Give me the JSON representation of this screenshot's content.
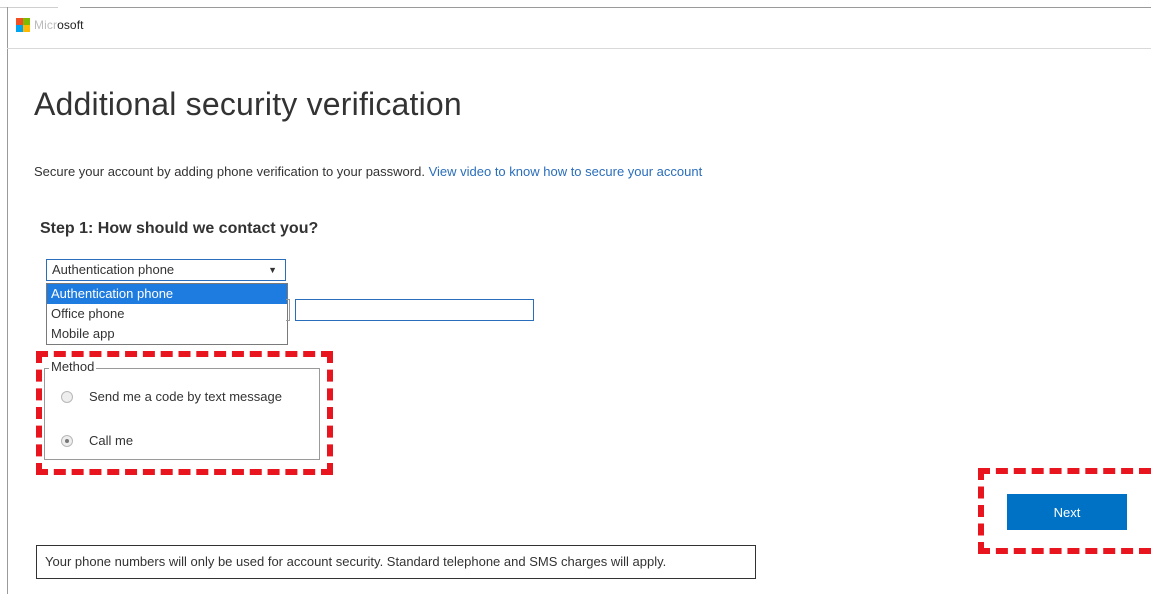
{
  "header": {
    "logo_text_visible": "osoft",
    "logo_text_obscured": "Micr",
    "logo_colors": [
      "#f25022",
      "#7fba00",
      "#00a4ef",
      "#ffb900"
    ]
  },
  "main": {
    "title": "Additional security verification",
    "intro_text": "Secure your account by adding phone verification to your password.",
    "intro_link": "View video to know how to secure your account",
    "step_title": "Step 1: How should we contact you?",
    "contact_select": {
      "selected": "Authentication phone",
      "options": [
        "Authentication phone",
        "Office phone",
        "Mobile app"
      ],
      "highlighted_index": 0
    },
    "phone_number_value": "",
    "method": {
      "legend": "Method",
      "options": [
        {
          "label": "Send me a code by text message",
          "checked": false
        },
        {
          "label": "Call me",
          "checked": true
        }
      ]
    },
    "next_label": "Next",
    "notice": "Your phone numbers will only be used for account security. Standard telephone and SMS charges will apply."
  },
  "colors": {
    "accent": "#0072c6",
    "link": "#2a6ebb",
    "highlight": "#e8141e",
    "dropdown_selected": "#1e7ce0"
  }
}
